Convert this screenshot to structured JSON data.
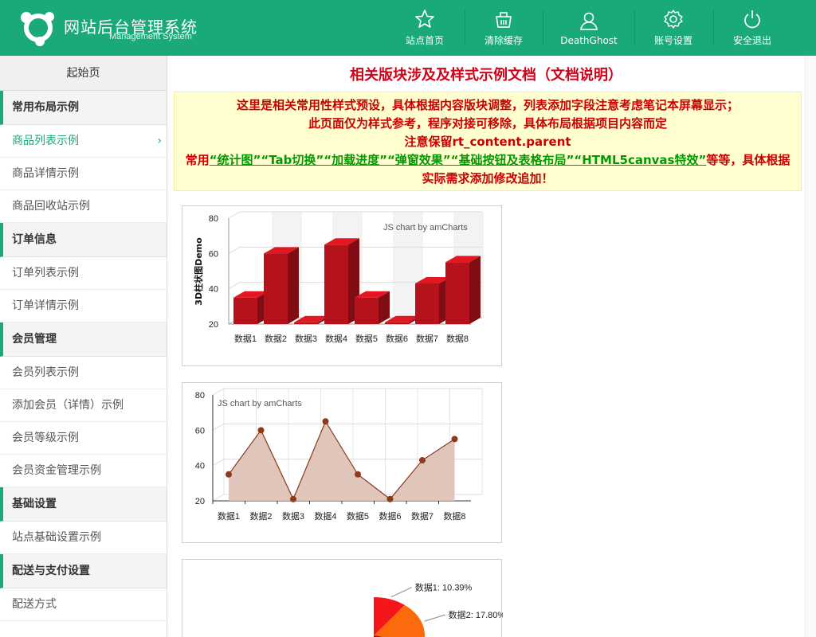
{
  "header": {
    "title_cn": "网站后台管理系统",
    "title_en": "Management System",
    "nav": [
      {
        "label": "站点首页",
        "icon": "star-icon"
      },
      {
        "label": "清除缓存",
        "icon": "basket-icon"
      },
      {
        "label": "DeathGhost",
        "icon": "user-icon"
      },
      {
        "label": "账号设置",
        "icon": "gear-icon"
      },
      {
        "label": "安全退出",
        "icon": "power-icon"
      }
    ]
  },
  "sidebar": {
    "home": "起始页",
    "groups": [
      {
        "title": "常用布局示例",
        "items": [
          "商品列表示例",
          "商品详情示例",
          "商品回收站示例"
        ]
      },
      {
        "title": "订单信息",
        "items": [
          "订单列表示例",
          "订单详情示例"
        ]
      },
      {
        "title": "会员管理",
        "items": [
          "会员列表示例",
          "添加会员（详情）示例",
          "会员等级示例",
          "会员资金管理示例"
        ]
      },
      {
        "title": "基础设置",
        "items": [
          "站点基础设置示例"
        ]
      },
      {
        "title": "配送与支付设置",
        "items": [
          "配送方式"
        ]
      }
    ],
    "active_item": "商品列表示例",
    "active_chevron": "›"
  },
  "main": {
    "title": "相关版块涉及及样式示例文档（文档说明）",
    "notice": {
      "line1": "这里是相关常用性样式预设，具体根据内容版块调整，列表添加字段注意考虑笔记本屏幕显示；",
      "line2": "此页面仅为样式参考，程序对接可移除，具体布局根据项目内容而定",
      "line3": "注意保留rt_content.parent",
      "line4_prefix": "常用",
      "links": [
        "“统计图”",
        "“Tab切换”",
        "“加载进度”",
        "“弹窗效果”",
        "“基础按钮及表格布局”",
        "“HTML5canvas特效”"
      ],
      "line4_suffix": "等等，具体根据",
      "line5": "实际需求添加修改追加！"
    }
  },
  "colors": {
    "header": "#19a97b",
    "bar": "#b5121b",
    "area_fill": "#ddbfb4",
    "area_line": "#8b3a1e",
    "notice_bg": "#ffffd0"
  },
  "chart_data": [
    {
      "type": "bar",
      "credit": "JS chart by amCharts",
      "ylabel": "3D柱状图Demo",
      "categories": [
        "数据1",
        "数据2",
        "数据3",
        "数据4",
        "数据5",
        "数据6",
        "数据7",
        "数据8"
      ],
      "values": [
        35,
        60,
        21,
        65,
        35,
        21,
        43,
        55
      ],
      "yticks": [
        20,
        40,
        60,
        80
      ],
      "ylim": [
        20,
        80
      ]
    },
    {
      "type": "area",
      "credit": "JS chart by amCharts",
      "categories": [
        "数据1",
        "数据2",
        "数据3",
        "数据4",
        "数据5",
        "数据6",
        "数据7",
        "数据8"
      ],
      "values": [
        35,
        60,
        21,
        65,
        35,
        21,
        43,
        55
      ],
      "yticks": [
        20,
        40,
        60,
        80
      ],
      "ylim": [
        20,
        80
      ]
    },
    {
      "type": "pie",
      "labels": [
        "数据1: 10.39%",
        "数据2: 17.80%"
      ],
      "slices": [
        {
          "label": "数据1",
          "percent": 10.39,
          "color": "#f5161c"
        },
        {
          "label": "数据2",
          "percent": 17.8,
          "color": "#fb6a0c"
        }
      ]
    }
  ]
}
